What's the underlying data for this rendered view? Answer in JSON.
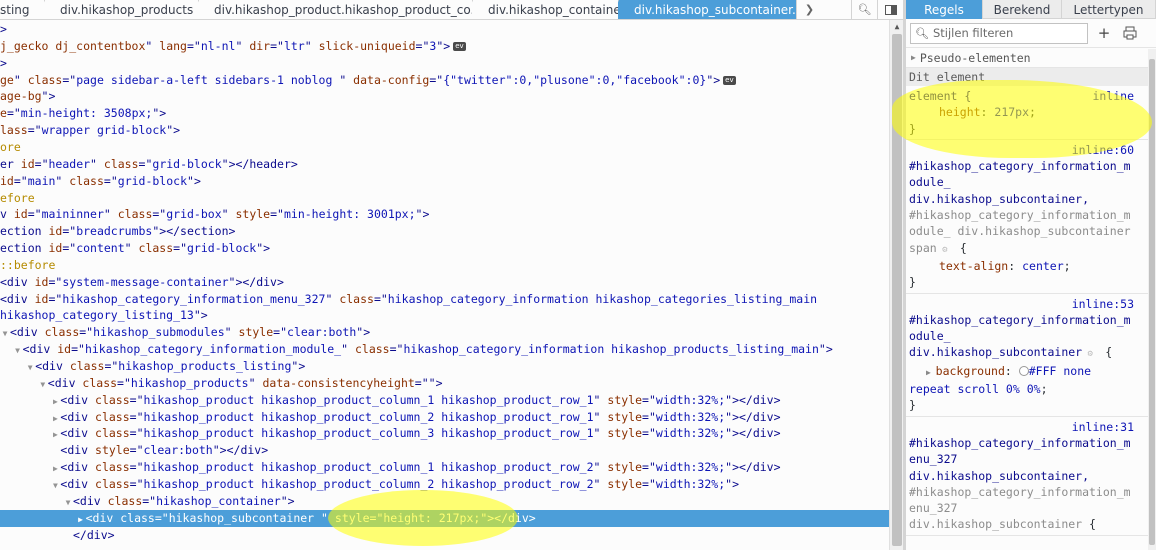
{
  "breadcrumbs": [
    "sting",
    "div.hikashop_products",
    "div.hikashop_product.hikashop_product_co...",
    "div.hikashop_container",
    "div.hikashop_subcontainer."
  ],
  "toolbar": {
    "next_icon": "chevron-right-icon",
    "search_icon": "search-icon",
    "dock_icon": "dock-side-icon"
  },
  "markup_lines": [
    {
      "indent": 0,
      "tw": "",
      "segs": [
        [
          "t",
          ">"
        ]
      ]
    },
    {
      "indent": 0,
      "tw": "",
      "segs": [
        [
          "an",
          "j_gecko dj_contentbox"
        ],
        [
          "t",
          "\" "
        ],
        [
          "an",
          "lang"
        ],
        [
          "t",
          "=\""
        ],
        [
          "av",
          "nl-nl"
        ],
        [
          "t",
          "\" "
        ],
        [
          "an",
          "dir"
        ],
        [
          "t",
          "=\""
        ],
        [
          "av",
          "ltr"
        ],
        [
          "t",
          "\" "
        ],
        [
          "an",
          "slick-uniqueid"
        ],
        [
          "t",
          "=\""
        ],
        [
          "av",
          "3"
        ],
        [
          "t",
          "\">"
        ]
      ],
      "badge": "ev"
    },
    {
      "indent": 0,
      "tw": "",
      "segs": [
        [
          "t",
          ">"
        ]
      ]
    },
    {
      "indent": 0,
      "tw": "",
      "segs": [
        [
          "an",
          "ge"
        ],
        [
          "t",
          "\" "
        ],
        [
          "an",
          "class"
        ],
        [
          "t",
          "=\""
        ],
        [
          "av",
          "page sidebar-a-left sidebars-1 noblog "
        ],
        [
          "t",
          "\" "
        ],
        [
          "an",
          "data-config"
        ],
        [
          "t",
          "=\""
        ],
        [
          "av",
          "{\"twitter\":0,\"plusone\":0,\"facebook\":0}"
        ],
        [
          "t",
          "\">"
        ]
      ],
      "badge": "ev"
    },
    {
      "indent": 0,
      "tw": "",
      "segs": [
        [
          "an",
          "age-bg"
        ],
        [
          "t",
          "\">"
        ]
      ]
    },
    {
      "indent": 0,
      "tw": "",
      "segs": [
        [
          "an",
          "e"
        ],
        [
          "t",
          "=\""
        ],
        [
          "av",
          "min-height: 3508px;"
        ],
        [
          "t",
          "\">"
        ]
      ]
    },
    {
      "indent": 0,
      "tw": "",
      "segs": [
        [
          "an",
          "lass"
        ],
        [
          "t",
          "=\""
        ],
        [
          "av",
          "wrapper grid-block"
        ],
        [
          "t",
          "\">"
        ]
      ]
    },
    {
      "indent": 0,
      "tw": "",
      "segs": [
        [
          "pe",
          "ore"
        ]
      ]
    },
    {
      "indent": 0,
      "tw": "",
      "segs": [
        [
          "t",
          "er "
        ],
        [
          "an",
          "id"
        ],
        [
          "t",
          "=\""
        ],
        [
          "av",
          "header"
        ],
        [
          "t",
          "\" "
        ],
        [
          "an",
          "class"
        ],
        [
          "t",
          "=\""
        ],
        [
          "av",
          "grid-block"
        ],
        [
          "t",
          "\"></header>"
        ]
      ]
    },
    {
      "indent": 0,
      "tw": "",
      "segs": [
        [
          "an",
          "id"
        ],
        [
          "t",
          "=\""
        ],
        [
          "av",
          "main"
        ],
        [
          "t",
          "\" "
        ],
        [
          "an",
          "class"
        ],
        [
          "t",
          "=\""
        ],
        [
          "av",
          "grid-block"
        ],
        [
          "t",
          "\">"
        ]
      ]
    },
    {
      "indent": 0,
      "tw": "",
      "segs": [
        [
          "pe",
          "efore"
        ]
      ]
    },
    {
      "indent": 0,
      "tw": "",
      "segs": [
        [
          "t",
          "v "
        ],
        [
          "an",
          "id"
        ],
        [
          "t",
          "=\""
        ],
        [
          "av",
          "maininner"
        ],
        [
          "t",
          "\" "
        ],
        [
          "an",
          "class"
        ],
        [
          "t",
          "=\""
        ],
        [
          "av",
          "grid-box"
        ],
        [
          "t",
          "\" "
        ],
        [
          "an",
          "style"
        ],
        [
          "t",
          "=\""
        ],
        [
          "av",
          "min-height: 3001px;"
        ],
        [
          "t",
          "\">"
        ]
      ]
    },
    {
      "indent": 0,
      "tw": "",
      "segs": [
        [
          "t",
          "ection "
        ],
        [
          "an",
          "id"
        ],
        [
          "t",
          "=\""
        ],
        [
          "av",
          "breadcrumbs"
        ],
        [
          "t",
          "\"></section>"
        ]
      ]
    },
    {
      "indent": 0,
      "tw": "",
      "segs": [
        [
          "t",
          "ection "
        ],
        [
          "an",
          "id"
        ],
        [
          "t",
          "=\""
        ],
        [
          "av",
          "content"
        ],
        [
          "t",
          "\" "
        ],
        [
          "an",
          "class"
        ],
        [
          "t",
          "=\""
        ],
        [
          "av",
          "grid-block"
        ],
        [
          "t",
          "\">"
        ]
      ]
    },
    {
      "indent": 0,
      "tw": "",
      "segs": [
        [
          "pe",
          "::before"
        ]
      ]
    },
    {
      "indent": 0,
      "tw": "",
      "segs": [
        [
          "t",
          "<div "
        ],
        [
          "an",
          "id"
        ],
        [
          "t",
          "=\""
        ],
        [
          "av",
          "system-message-container"
        ],
        [
          "t",
          "\"></div>"
        ]
      ]
    },
    {
      "indent": 0,
      "tw": "",
      "segs": [
        [
          "t",
          "<div "
        ],
        [
          "an",
          "id"
        ],
        [
          "t",
          "=\""
        ],
        [
          "av",
          "hikashop_category_information_menu_327"
        ],
        [
          "t",
          "\" "
        ],
        [
          "an",
          "class"
        ],
        [
          "t",
          "=\""
        ],
        [
          "av",
          "hikashop_category_information hikashop_categories_listing_main"
        ]
      ]
    },
    {
      "indent": 0,
      "tw": "",
      "segs": [
        [
          "av",
          "hikashop_category_listing_13"
        ],
        [
          "t",
          "\">"
        ]
      ]
    },
    {
      "indent": 0,
      "tw": "▼",
      "segs": [
        [
          "t",
          "<div "
        ],
        [
          "an",
          "class"
        ],
        [
          "t",
          "=\""
        ],
        [
          "av",
          "hikashop_submodules"
        ],
        [
          "t",
          "\" "
        ],
        [
          "an",
          "style"
        ],
        [
          "t",
          "=\""
        ],
        [
          "av",
          "clear:both"
        ],
        [
          "t",
          "\">"
        ]
      ]
    },
    {
      "indent": 1,
      "tw": "▼",
      "segs": [
        [
          "t",
          "<div "
        ],
        [
          "an",
          "id"
        ],
        [
          "t",
          "=\""
        ],
        [
          "av",
          "hikashop_category_information_module_"
        ],
        [
          "t",
          "\" "
        ],
        [
          "an",
          "class"
        ],
        [
          "t",
          "=\""
        ],
        [
          "av",
          "hikashop_category_information hikashop_products_listing_main"
        ],
        [
          "t",
          "\">"
        ]
      ]
    },
    {
      "indent": 2,
      "tw": "▼",
      "segs": [
        [
          "t",
          "<div "
        ],
        [
          "an",
          "class"
        ],
        [
          "t",
          "=\""
        ],
        [
          "av",
          "hikashop_products_listing"
        ],
        [
          "t",
          "\">"
        ]
      ]
    },
    {
      "indent": 3,
      "tw": "▼",
      "segs": [
        [
          "t",
          "<div "
        ],
        [
          "an",
          "class"
        ],
        [
          "t",
          "=\""
        ],
        [
          "av",
          "hikashop_products"
        ],
        [
          "t",
          "\" "
        ],
        [
          "an",
          "data-consistencyheight"
        ],
        [
          "t",
          "=\"\">"
        ]
      ]
    },
    {
      "indent": 4,
      "tw": "▶",
      "segs": [
        [
          "t",
          "<div "
        ],
        [
          "an",
          "class"
        ],
        [
          "t",
          "=\""
        ],
        [
          "av",
          "hikashop_product hikashop_product_column_1 hikashop_product_row_1"
        ],
        [
          "t",
          "\" "
        ],
        [
          "an",
          "style"
        ],
        [
          "t",
          "=\""
        ],
        [
          "av",
          "width:32%;"
        ],
        [
          "t",
          "\"></div>"
        ]
      ]
    },
    {
      "indent": 4,
      "tw": "▶",
      "segs": [
        [
          "t",
          "<div "
        ],
        [
          "an",
          "class"
        ],
        [
          "t",
          "=\""
        ],
        [
          "av",
          "hikashop_product hikashop_product_column_2 hikashop_product_row_1"
        ],
        [
          "t",
          "\" "
        ],
        [
          "an",
          "style"
        ],
        [
          "t",
          "=\""
        ],
        [
          "av",
          "width:32%;"
        ],
        [
          "t",
          "\"></div>"
        ]
      ]
    },
    {
      "indent": 4,
      "tw": "▶",
      "segs": [
        [
          "t",
          "<div "
        ],
        [
          "an",
          "class"
        ],
        [
          "t",
          "=\""
        ],
        [
          "av",
          "hikashop_product hikashop_product_column_3 hikashop_product_row_1"
        ],
        [
          "t",
          "\" "
        ],
        [
          "an",
          "style"
        ],
        [
          "t",
          "=\""
        ],
        [
          "av",
          "width:32%;"
        ],
        [
          "t",
          "\"></div>"
        ]
      ]
    },
    {
      "indent": 4,
      "tw": "",
      "segs": [
        [
          "t",
          "<div "
        ],
        [
          "an",
          "style"
        ],
        [
          "t",
          "=\""
        ],
        [
          "av",
          "clear:both"
        ],
        [
          "t",
          "\"></div>"
        ]
      ]
    },
    {
      "indent": 4,
      "tw": "▶",
      "segs": [
        [
          "t",
          "<div "
        ],
        [
          "an",
          "class"
        ],
        [
          "t",
          "=\""
        ],
        [
          "av",
          "hikashop_product hikashop_product_column_1 hikashop_product_row_2"
        ],
        [
          "t",
          "\" "
        ],
        [
          "an",
          "style"
        ],
        [
          "t",
          "=\""
        ],
        [
          "av",
          "width:32%;"
        ],
        [
          "t",
          "\"></div>"
        ]
      ]
    },
    {
      "indent": 4,
      "tw": "▼",
      "segs": [
        [
          "t",
          "<div "
        ],
        [
          "an",
          "class"
        ],
        [
          "t",
          "=\""
        ],
        [
          "av",
          "hikashop_product hikashop_product_column_2 hikashop_product_row_2"
        ],
        [
          "t",
          "\" "
        ],
        [
          "an",
          "style"
        ],
        [
          "t",
          "=\""
        ],
        [
          "av",
          "width:32%;"
        ],
        [
          "t",
          "\">"
        ]
      ]
    },
    {
      "indent": 5,
      "tw": "▼",
      "segs": [
        [
          "t",
          "<div "
        ],
        [
          "an",
          "class"
        ],
        [
          "t",
          "=\""
        ],
        [
          "av",
          "hikashop_container"
        ],
        [
          "t",
          "\">"
        ]
      ]
    },
    {
      "indent": 6,
      "tw": "▶",
      "selected": true,
      "segs": [
        [
          "t",
          "<div "
        ],
        [
          "an",
          "class"
        ],
        [
          "t",
          "=\""
        ],
        [
          "av",
          "hikashop_subcontainer "
        ],
        [
          "t",
          "\" "
        ],
        [
          "an",
          "style"
        ],
        [
          "t",
          "=\""
        ],
        [
          "av",
          "height: 217px;"
        ],
        [
          "t",
          "\"></div>"
        ]
      ]
    },
    {
      "indent": 5,
      "tw": "",
      "segs": [
        [
          "t",
          "</div>"
        ]
      ]
    }
  ],
  "rules_panel": {
    "tabs": [
      "Regels",
      "Berekend",
      "Lettertypen"
    ],
    "filter_placeholder": "Stijlen filteren",
    "add_icon": "plus-icon",
    "print_icon": "print-simulation-icon",
    "pseudo_label": "Pseudo-elementen",
    "element_header": "Dit element",
    "element_rule": {
      "selector": "element {",
      "source": "inline",
      "prop": "height",
      "value": "217px",
      "close": "}"
    },
    "rules": [
      {
        "source": "inline:60",
        "selectors": [
          {
            "text": "#hikashop_category_information_m",
            "dim": false
          },
          {
            "text": "odule_",
            "dim": false
          },
          {
            "text": "div.hikashop_subcontainer,",
            "dim": false
          },
          {
            "text": "#hikashop_category_information_m",
            "dim": true
          },
          {
            "text": "odule_ div.hikashop_subcontainer",
            "dim": true
          },
          {
            "text": "span",
            "dim": true,
            "gear": true
          }
        ],
        "decls": [
          {
            "prop": "text-align",
            "value": "center"
          }
        ]
      },
      {
        "source": "inline:53",
        "selectors": [
          {
            "text": "#hikashop_category_information_m",
            "dim": false
          },
          {
            "text": "odule_",
            "dim": false
          },
          {
            "text": "div.hikashop_subcontainer",
            "dim": false,
            "gear": true
          }
        ],
        "decls": [
          {
            "prop": "background",
            "value": "#FFF none",
            "swatch": true,
            "expand": true,
            "cont": "repeat scroll 0% 0%"
          }
        ]
      },
      {
        "source": "inline:31",
        "selectors": [
          {
            "text": "#hikashop_category_information_m",
            "dim": false
          },
          {
            "text": "enu_327",
            "dim": false
          },
          {
            "text": "div.hikashop_subcontainer,",
            "dim": false
          },
          {
            "text": "#hikashop_category_information_m",
            "dim": true
          },
          {
            "text": "enu_327",
            "dim": true
          },
          {
            "text": "div.hikashop_subcontainer",
            "dim": true
          }
        ],
        "decls": []
      }
    ]
  },
  "colors": {
    "selection": "#4c9ed9",
    "highlight": "#ffff00"
  }
}
